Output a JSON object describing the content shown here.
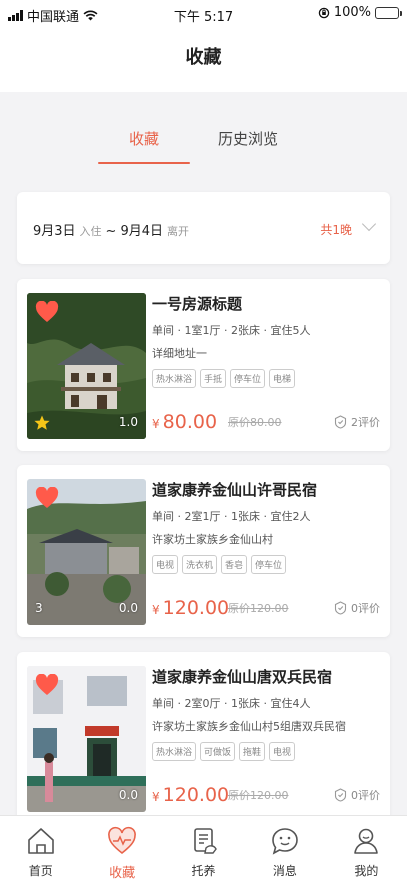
{
  "status_bar": {
    "carrier": "中国联通",
    "time": "下午 5:17",
    "battery": "100%"
  },
  "nav": {
    "title": "收藏"
  },
  "tabs": [
    {
      "label": "收藏"
    },
    {
      "label": "历史浏览"
    }
  ],
  "date_filter": {
    "checkin_date": "9月3日",
    "checkin_label": "入住",
    "separator": "~",
    "checkout_date": "9月4日",
    "checkout_label": "离开",
    "nights": "共1晚"
  },
  "listings": [
    {
      "title": "一号房源标题",
      "spec": "单间 · 1室1厅 · 2张床 · 宜住5人",
      "address": "详细地址一",
      "tags": [
        "热水淋浴",
        "手抵",
        "停车位",
        "电梯"
      ],
      "currency": "¥",
      "price": "80.00",
      "original_price": "原价80.00",
      "reviews": "2评价",
      "image_rating": "1.0",
      "image_mark": ""
    },
    {
      "title": "道家康养金仙山许哥民宿",
      "spec": "单间 · 2室1厅 · 1张床 · 宜住2人",
      "address": "许家坊土家族乡金仙山村",
      "tags": [
        "电视",
        "洗衣机",
        "香皂",
        "停车位"
      ],
      "currency": "¥",
      "price": "120.00",
      "original_price": "原价120.00",
      "reviews": "0评价",
      "image_rating": "0.0",
      "image_mark": "3"
    },
    {
      "title": "道家康养金仙山唐双兵民宿",
      "spec": "单间 · 2室0厅 · 1张床 · 宜住4人",
      "address": "许家坊土家族乡金仙山村5组唐双兵民宿",
      "tags": [
        "热水淋浴",
        "可做饭",
        "拖鞋",
        "电视"
      ],
      "currency": "¥",
      "price": "120.00",
      "original_price": "原价120.00",
      "reviews": "0评价",
      "image_rating": "0.0",
      "image_mark": ""
    }
  ],
  "tab_bar": [
    {
      "label": "首页",
      "icon": "home-icon"
    },
    {
      "label": "收藏",
      "icon": "heart-icon",
      "active": true
    },
    {
      "label": "托养",
      "icon": "document-icon"
    },
    {
      "label": "消息",
      "icon": "message-icon"
    },
    {
      "label": "我的",
      "icon": "profile-icon"
    }
  ],
  "colors": {
    "accent": "#e8634a",
    "background": "#f3f3f5"
  }
}
